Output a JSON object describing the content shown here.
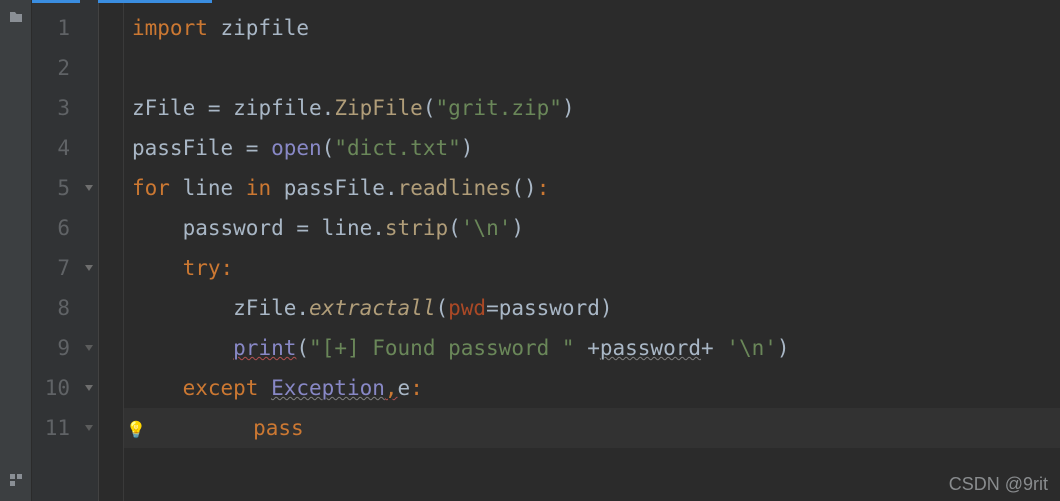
{
  "watermark": "CSDN @9rit",
  "gutter": {
    "lines": [
      "1",
      "2",
      "3",
      "4",
      "5",
      "6",
      "7",
      "8",
      "9",
      "10",
      "11"
    ]
  },
  "fold": {
    "markers": [
      "",
      "",
      "",
      "",
      "down",
      "",
      "down",
      "",
      "end",
      "down",
      "end-bulb"
    ]
  },
  "code": {
    "l1": {
      "kw": "import",
      "id": " zipfile"
    },
    "l2": {
      "blank": ""
    },
    "l3": {
      "v": "zFile ",
      "eq": "= ",
      "m": "zipfile",
      "dot": ".",
      "call": "ZipFile",
      "p1": "(",
      "s": "\"grit.zip\"",
      "p2": ")"
    },
    "l4": {
      "v": "passFile ",
      "eq": "= ",
      "call": "open",
      "p1": "(",
      "s": "\"dict.txt\"",
      "p2": ")"
    },
    "l5": {
      "kw": "for",
      "sp": " ",
      "v1": "line",
      "sp2": " ",
      "kw2": "in",
      "sp3": " ",
      "obj": "passFile",
      "dot": ".",
      "call": "readlines",
      "p": "()",
      "c": ":"
    },
    "l6": {
      "ind": "    ",
      "v": "password ",
      "eq": "= ",
      "obj": "line",
      "dot": ".",
      "call": "strip",
      "p1": "(",
      "s": "'\\n'",
      "p2": ")"
    },
    "l7": {
      "ind": "    ",
      "kw": "try",
      "c": ":"
    },
    "l8": {
      "ind": "        ",
      "obj": "zFile",
      "dot": ".",
      "call": "extractall",
      "p1": "(",
      "par": "pwd",
      "eq": "=",
      "v": "password",
      "p2": ")"
    },
    "l9": {
      "ind": "        ",
      "call": "print",
      "p1": "(",
      "s1": "\"[+] Found password \"",
      "sp": " ",
      "plus1": "+",
      "v": "password",
      "plus2": "+",
      "sp2": " ",
      "s2": "'\\n'",
      "p2": ")"
    },
    "l10": {
      "ind": "    ",
      "kw": "except",
      "sp": " ",
      "exc": "Exception",
      "comma": ",",
      "v": "e",
      "c": ":"
    },
    "l11": {
      "ind": "        ",
      "kw": "pass"
    }
  }
}
